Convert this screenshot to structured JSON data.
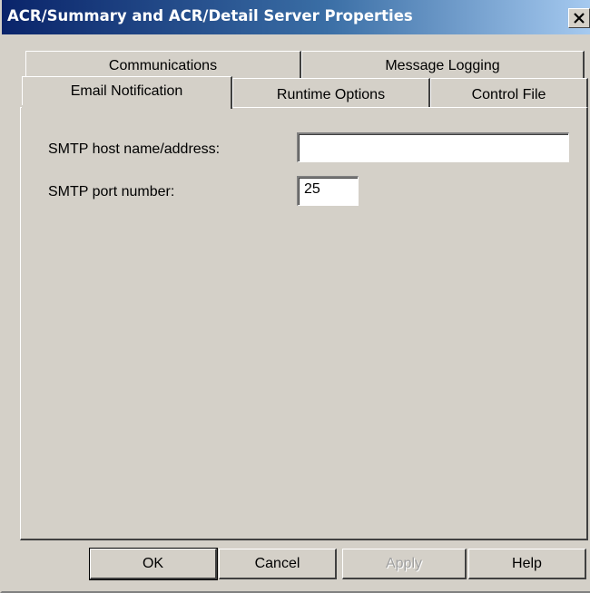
{
  "window": {
    "title": "ACR/Summary and ACR/Detail Server Properties",
    "close_glyph": "✕"
  },
  "tabs": {
    "back_row": [
      {
        "label": "Communications"
      },
      {
        "label": "Message Logging"
      }
    ],
    "front_row": [
      {
        "label": "Email Notification",
        "selected": true
      },
      {
        "label": "Runtime Options",
        "selected": false
      },
      {
        "label": "Control File",
        "selected": false
      }
    ]
  },
  "form": {
    "smtp_host_label": "SMTP host name/address:",
    "smtp_host_value": "",
    "smtp_port_label": "SMTP port number:",
    "smtp_port_value": "25"
  },
  "buttons": {
    "ok": "OK",
    "cancel": "Cancel",
    "apply": "Apply",
    "help": "Help"
  },
  "colors": {
    "title_gradient_start": "#0a246a",
    "title_gradient_end": "#a6caf0",
    "face": "#d4d0c8",
    "disabled_text": "#a0a0a0"
  }
}
